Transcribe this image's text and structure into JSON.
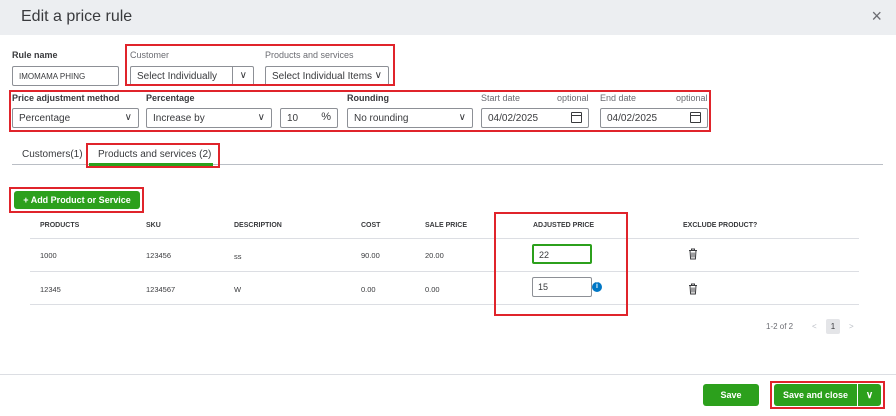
{
  "dialog": {
    "title": "Edit a price rule",
    "close_icon": "×"
  },
  "rule_name": {
    "label": "Rule name",
    "value": "IMOMAMA PHING"
  },
  "customer": {
    "label": "Customer",
    "value": "Select Individually"
  },
  "products_services": {
    "label": "Products and services",
    "value": "Select Individual Items"
  },
  "adjustment": {
    "method_label": "Price adjustment method",
    "method_value": "Percentage",
    "percentage_label": "Percentage",
    "percentage_value": "Increase by",
    "amount_value": "10",
    "amount_suffix": "%",
    "rounding_label": "Rounding",
    "rounding_value": "No rounding",
    "start_label": "Start date",
    "start_optional": "optional",
    "start_value": "04/02/2025",
    "end_label": "End date",
    "end_optional": "optional",
    "end_value": "04/02/2025"
  },
  "tabs": [
    {
      "label": "Customers(1)"
    },
    {
      "label": "Products and services (2)"
    }
  ],
  "add_button": {
    "label": "+ Add Product or Service"
  },
  "table": {
    "headers": [
      "PRODUCTS",
      "SKU",
      "DESCRIPTION",
      "COST",
      "SALE PRICE",
      "ADJUSTED PRICE",
      "EXCLUDE PRODUCT?"
    ],
    "rows": [
      {
        "product": "1000",
        "sku": "123456",
        "description": "ss",
        "cost": "90.00",
        "sale_price": "20.00",
        "adjusted": "22"
      },
      {
        "product": "12345",
        "sku": "1234567",
        "description": "W",
        "cost": "0.00",
        "sale_price": "0.00",
        "adjusted": "15"
      }
    ]
  },
  "pagination": {
    "range": "1-2 of 2",
    "prev": "<",
    "page": "1",
    "next": ">"
  },
  "footer": {
    "save": "Save",
    "save_close": "Save and close",
    "dropdown": "∨"
  },
  "icons": {
    "chevron": "∨",
    "info": "i"
  },
  "colors": {
    "accent": "#2ca01c",
    "highlight": "#e0242b",
    "info": "#0077c5"
  }
}
